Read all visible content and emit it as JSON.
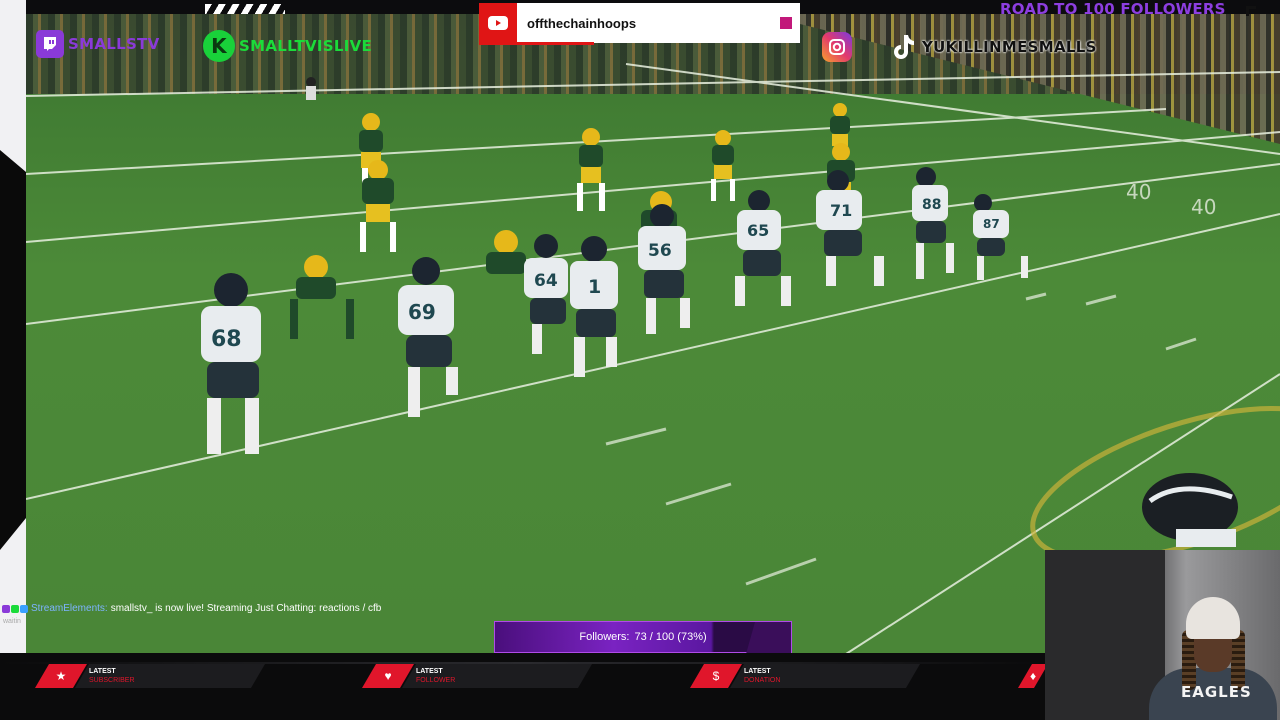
{
  "top": {
    "twitch_handle": "SMALLSTV",
    "kick_handle": "SMALLTVISLIVE",
    "tiktok_handle": "YUKILLINMESMALLS",
    "youtube_channel": "offthechainhoops",
    "road_title": "ROAD TO 100 FOLLOWERS"
  },
  "chat": {
    "user": "StreamElements:",
    "message": "smallstv_ is now live! Streaming Just Chatting: reactions / cfb",
    "footer": "waitin"
  },
  "goal": {
    "label": "Followers:",
    "current": 73,
    "target": 100,
    "text": "73 / 100 (73%)"
  },
  "bottom": {
    "latest_subscriber": {
      "title": "LATEST",
      "subtitle": "SUBSCRIBER"
    },
    "latest_follower": {
      "title": "LATEST",
      "subtitle": "FOLLOWER"
    },
    "latest_donation": {
      "title": "LATEST",
      "subtitle": "DONATION"
    }
  },
  "webcam": {
    "shirt_text": "EAGLES"
  },
  "game": {
    "jersey_numbers": [
      "68",
      "69",
      "64",
      "1",
      "56",
      "65",
      "71",
      "88",
      "87"
    ],
    "yard_numbers": [
      "40",
      "40"
    ]
  },
  "colors": {
    "twitch": "#8a3ad8",
    "kick": "#1bdb3a",
    "youtube": "#e01515",
    "goal_purple": "#7a23c2",
    "alert_red": "#e0162b",
    "field_green": "#4c8a38"
  },
  "icons": [
    "twitch-icon",
    "kick-icon",
    "youtube-icon",
    "instagram-icon",
    "tiktok-icon",
    "star-icon",
    "heart-icon",
    "dollar-icon",
    "gem-icon"
  ]
}
